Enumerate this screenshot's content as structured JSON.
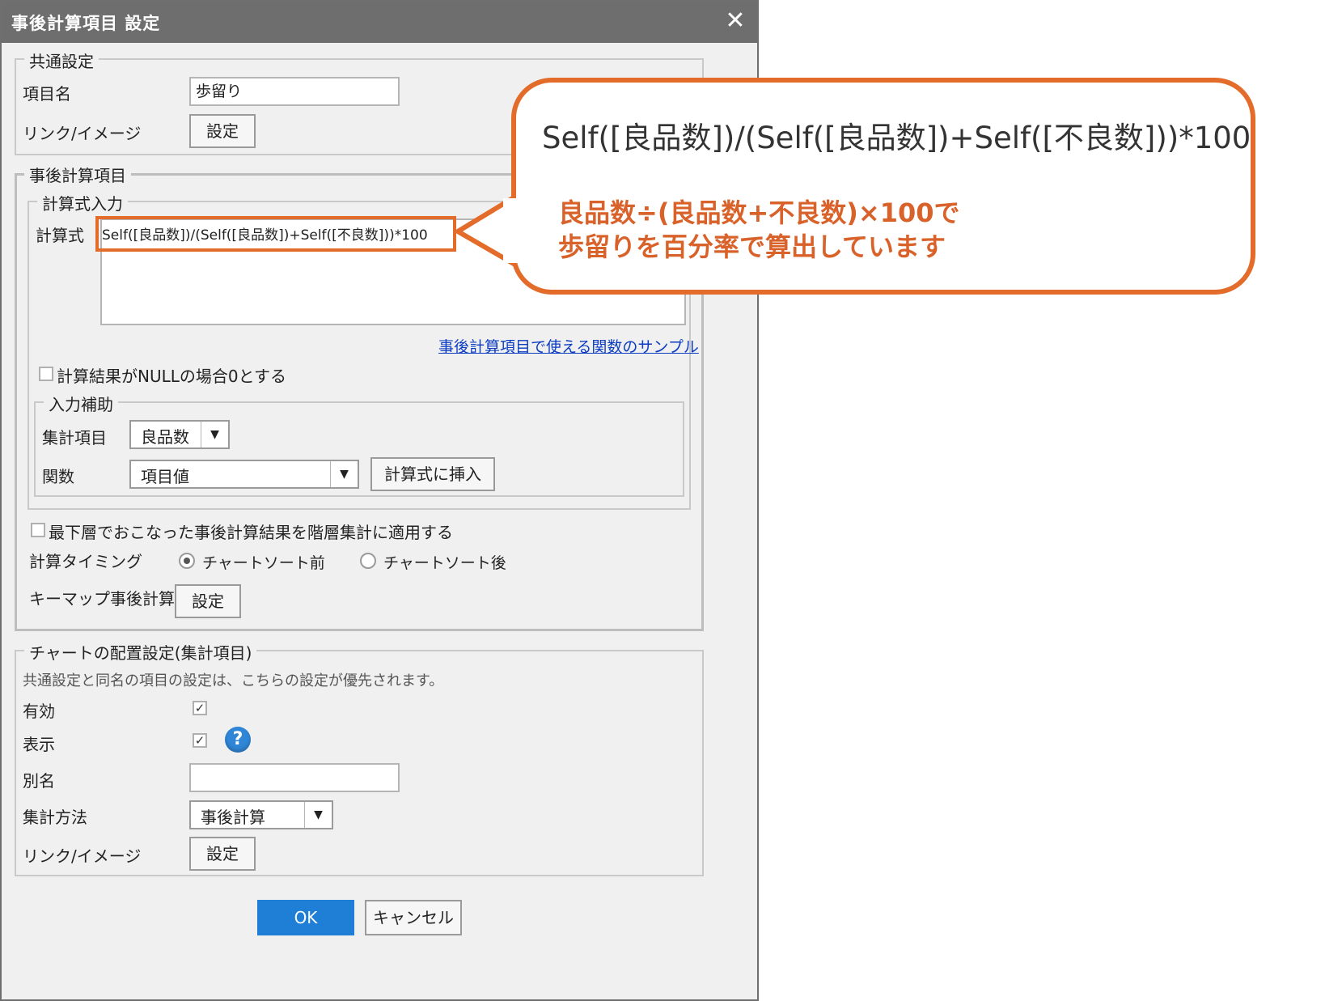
{
  "dialog": {
    "title": "事後計算項目 設定",
    "close_glyph": "✕"
  },
  "common": {
    "legend": "共通設定",
    "item_name_label": "項目名",
    "item_name_value": "歩留り",
    "link_label": "リンク/イメージ",
    "link_button": "設定"
  },
  "postcalc": {
    "legend": "事後計算項目",
    "formula_legend": "計算式入力",
    "formula_label": "計算式",
    "formula_value": "Self([良品数])/(Self([良品数])+Self([不良数]))*100",
    "sample_link": "事後計算項目で使える関数のサンプル",
    "null_zero_label": "計算結果がNULLの場合0とする",
    "input_assist_legend": "入力補助",
    "agg_item_label": "集計項目",
    "agg_item_value": "良品数",
    "function_label": "関数",
    "function_value": "項目値",
    "insert_button": "計算式に挿入",
    "apply_hierarchy_label": "最下層でおこなった事後計算結果を階層集計に適用する",
    "timing_label": "計算タイミング",
    "timing_before": "チャートソート前",
    "timing_after": "チャートソート後",
    "timing_selected": "before",
    "keymap_label": "キーマップ事後計算",
    "keymap_button": "設定"
  },
  "placement": {
    "legend": "チャートの配置設定(集計項目)",
    "note": "共通設定と同名の項目の設定は、こちらの設定が優先されます。",
    "enabled_label": "有効",
    "enabled_checked": true,
    "display_label": "表示",
    "display_checked": true,
    "alias_label": "別名",
    "alias_value": "",
    "agg_method_label": "集計方法",
    "agg_method_value": "事後計算",
    "link_label": "リンク/イメージ",
    "link_button": "設定"
  },
  "footer": {
    "ok": "OK",
    "cancel": "キャンセル"
  },
  "callout": {
    "formula": "Self([良品数])/(Self([良品数])+Self([不良数]))*100",
    "note_line1": "良品数÷(良品数+不良数)×100で",
    "note_line2": "歩留りを百分率で算出しています"
  },
  "colors": {
    "accent_orange": "#e36c2b",
    "ok_button": "#1f7fd6",
    "titlebar": "#6e6e6e"
  }
}
